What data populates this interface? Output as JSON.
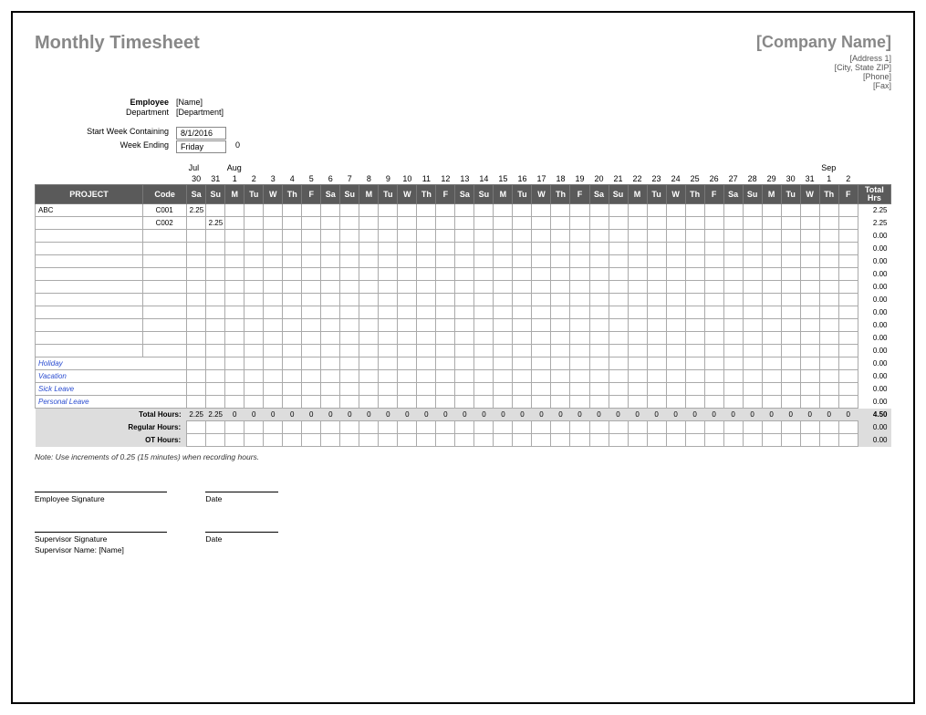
{
  "title": "Monthly Timesheet",
  "company": {
    "name": "[Company Name]",
    "address1": "[Address 1]",
    "city_state_zip": "[City, State ZIP]",
    "phone": "[Phone]",
    "fax": "[Fax]"
  },
  "info": {
    "employee_label": "Employee",
    "employee_value": "[Name]",
    "department_label": "Department",
    "department_value": "[Department]",
    "start_label": "Start Week Containing",
    "start_value": "8/1/2016",
    "week_ending_label": "Week Ending",
    "week_ending_value": "Friday",
    "week_ending_extra": "0"
  },
  "months": [
    "",
    "",
    "Jul",
    "",
    "Aug",
    "",
    "",
    "",
    "",
    "",
    "",
    "",
    "",
    "",
    "",
    "",
    "",
    "",
    "",
    "",
    "",
    "",
    "",
    "",
    "",
    "",
    "",
    "",
    "",
    "",
    "",
    "",
    "",
    "",
    "",
    "Sep",
    "",
    ""
  ],
  "dates": [
    "",
    "",
    "30",
    "31",
    "1",
    "2",
    "3",
    "4",
    "5",
    "6",
    "7",
    "8",
    "9",
    "10",
    "11",
    "12",
    "13",
    "14",
    "15",
    "16",
    "17",
    "18",
    "19",
    "20",
    "21",
    "22",
    "23",
    "24",
    "25",
    "26",
    "27",
    "28",
    "29",
    "30",
    "31",
    "1",
    "2",
    ""
  ],
  "day_hdr": [
    "PROJECT",
    "Code",
    "Sa",
    "Su",
    "M",
    "Tu",
    "W",
    "Th",
    "F",
    "Sa",
    "Su",
    "M",
    "Tu",
    "W",
    "Th",
    "F",
    "Sa",
    "Su",
    "M",
    "Tu",
    "W",
    "Th",
    "F",
    "Sa",
    "Su",
    "M",
    "Tu",
    "W",
    "Th",
    "F",
    "Sa",
    "Su",
    "M",
    "Tu",
    "W",
    "Th",
    "F",
    "Total Hrs"
  ],
  "rows": [
    {
      "project": "ABC",
      "code": "C001",
      "cells": [
        "2.25",
        "",
        "",
        "",
        "",
        "",
        "",
        "",
        "",
        "",
        "",
        "",
        "",
        "",
        "",
        "",
        "",
        "",
        "",
        "",
        "",
        "",
        "",
        "",
        "",
        "",
        "",
        "",
        "",
        "",
        "",
        "",
        "",
        "",
        ""
      ],
      "total": "2.25"
    },
    {
      "project": "",
      "code": "C002",
      "cells": [
        "",
        "2.25",
        "",
        "",
        "",
        "",
        "",
        "",
        "",
        "",
        "",
        "",
        "",
        "",
        "",
        "",
        "",
        "",
        "",
        "",
        "",
        "",
        "",
        "",
        "",
        "",
        "",
        "",
        "",
        "",
        "",
        "",
        "",
        "",
        ""
      ],
      "total": "2.25"
    },
    {
      "project": "",
      "code": "",
      "cells": [
        "",
        "",
        "",
        "",
        "",
        "",
        "",
        "",
        "",
        "",
        "",
        "",
        "",
        "",
        "",
        "",
        "",
        "",
        "",
        "",
        "",
        "",
        "",
        "",
        "",
        "",
        "",
        "",
        "",
        "",
        "",
        "",
        "",
        "",
        ""
      ],
      "total": "0.00"
    },
    {
      "project": "",
      "code": "",
      "cells": [
        "",
        "",
        "",
        "",
        "",
        "",
        "",
        "",
        "",
        "",
        "",
        "",
        "",
        "",
        "",
        "",
        "",
        "",
        "",
        "",
        "",
        "",
        "",
        "",
        "",
        "",
        "",
        "",
        "",
        "",
        "",
        "",
        "",
        "",
        ""
      ],
      "total": "0.00"
    },
    {
      "project": "",
      "code": "",
      "cells": [
        "",
        "",
        "",
        "",
        "",
        "",
        "",
        "",
        "",
        "",
        "",
        "",
        "",
        "",
        "",
        "",
        "",
        "",
        "",
        "",
        "",
        "",
        "",
        "",
        "",
        "",
        "",
        "",
        "",
        "",
        "",
        "",
        "",
        "",
        ""
      ],
      "total": "0.00"
    },
    {
      "project": "",
      "code": "",
      "cells": [
        "",
        "",
        "",
        "",
        "",
        "",
        "",
        "",
        "",
        "",
        "",
        "",
        "",
        "",
        "",
        "",
        "",
        "",
        "",
        "",
        "",
        "",
        "",
        "",
        "",
        "",
        "",
        "",
        "",
        "",
        "",
        "",
        "",
        "",
        ""
      ],
      "total": "0.00"
    },
    {
      "project": "",
      "code": "",
      "cells": [
        "",
        "",
        "",
        "",
        "",
        "",
        "",
        "",
        "",
        "",
        "",
        "",
        "",
        "",
        "",
        "",
        "",
        "",
        "",
        "",
        "",
        "",
        "",
        "",
        "",
        "",
        "",
        "",
        "",
        "",
        "",
        "",
        "",
        "",
        ""
      ],
      "total": "0.00"
    },
    {
      "project": "",
      "code": "",
      "cells": [
        "",
        "",
        "",
        "",
        "",
        "",
        "",
        "",
        "",
        "",
        "",
        "",
        "",
        "",
        "",
        "",
        "",
        "",
        "",
        "",
        "",
        "",
        "",
        "",
        "",
        "",
        "",
        "",
        "",
        "",
        "",
        "",
        "",
        "",
        ""
      ],
      "total": "0.00"
    },
    {
      "project": "",
      "code": "",
      "cells": [
        "",
        "",
        "",
        "",
        "",
        "",
        "",
        "",
        "",
        "",
        "",
        "",
        "",
        "",
        "",
        "",
        "",
        "",
        "",
        "",
        "",
        "",
        "",
        "",
        "",
        "",
        "",
        "",
        "",
        "",
        "",
        "",
        "",
        "",
        ""
      ],
      "total": "0.00"
    },
    {
      "project": "",
      "code": "",
      "cells": [
        "",
        "",
        "",
        "",
        "",
        "",
        "",
        "",
        "",
        "",
        "",
        "",
        "",
        "",
        "",
        "",
        "",
        "",
        "",
        "",
        "",
        "",
        "",
        "",
        "",
        "",
        "",
        "",
        "",
        "",
        "",
        "",
        "",
        "",
        ""
      ],
      "total": "0.00"
    },
    {
      "project": "",
      "code": "",
      "cells": [
        "",
        "",
        "",
        "",
        "",
        "",
        "",
        "",
        "",
        "",
        "",
        "",
        "",
        "",
        "",
        "",
        "",
        "",
        "",
        "",
        "",
        "",
        "",
        "",
        "",
        "",
        "",
        "",
        "",
        "",
        "",
        "",
        "",
        "",
        ""
      ],
      "total": "0.00"
    },
    {
      "project": "",
      "code": "",
      "cells": [
        "",
        "",
        "",
        "",
        "",
        "",
        "",
        "",
        "",
        "",
        "",
        "",
        "",
        "",
        "",
        "",
        "",
        "",
        "",
        "",
        "",
        "",
        "",
        "",
        "",
        "",
        "",
        "",
        "",
        "",
        "",
        "",
        "",
        "",
        ""
      ],
      "total": "0.00"
    }
  ],
  "special_rows": [
    {
      "label": "Holiday",
      "total": "0.00"
    },
    {
      "label": "Vacation",
      "total": "0.00"
    },
    {
      "label": "Sick Leave",
      "total": "0.00"
    },
    {
      "label": "Personal Leave",
      "total": "0.00"
    }
  ],
  "totals": {
    "label": "Total Hours:",
    "cells": [
      "2.25",
      "2.25",
      "0",
      "0",
      "0",
      "0",
      "0",
      "0",
      "0",
      "0",
      "0",
      "0",
      "0",
      "0",
      "0",
      "0",
      "0",
      "0",
      "0",
      "0",
      "0",
      "0",
      "0",
      "0",
      "0",
      "0",
      "0",
      "0",
      "0",
      "0",
      "0",
      "0",
      "0",
      "0",
      "0"
    ],
    "grand": "4.50",
    "regular_label": "Regular Hours:",
    "regular_total": "0.00",
    "ot_label": "OT Hours:",
    "ot_total": "0.00"
  },
  "note": "Note: Use increments of 0.25 (15 minutes) when recording hours.",
  "signatures": {
    "emp_sig": "Employee Signature",
    "date": "Date",
    "sup_sig": "Supervisor Signature",
    "sup_name_label": "Supervisor Name:",
    "sup_name_value": "[Name]"
  }
}
